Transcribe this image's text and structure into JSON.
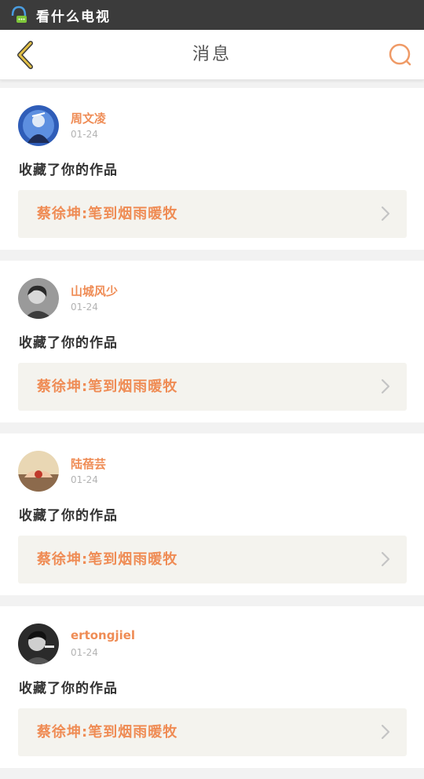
{
  "status_bar": {
    "app_name": "看什么电视"
  },
  "header": {
    "title": "消息",
    "back_icon": "chevron-left-icon",
    "search_icon": "search-icon"
  },
  "colors": {
    "accent": "#ef8c55",
    "back_arrow": "#c9a227",
    "status_bar": "#3b3b3b"
  },
  "messages": [
    {
      "user": "周文凌",
      "date": "01-24",
      "action": "收藏了你的作品",
      "work": "蔡徐坤:笔到烟雨暖牧"
    },
    {
      "user": "山城风少",
      "date": "01-24",
      "action": "收藏了你的作品",
      "work": "蔡徐坤:笔到烟雨暖牧"
    },
    {
      "user": "陆蓓芸",
      "date": "01-24",
      "action": "收藏了你的作品",
      "work": "蔡徐坤:笔到烟雨暖牧"
    },
    {
      "user": "ertongjiel",
      "date": "01-24",
      "action": "收藏了你的作品",
      "work": "蔡徐坤:笔到烟雨暖牧"
    }
  ]
}
